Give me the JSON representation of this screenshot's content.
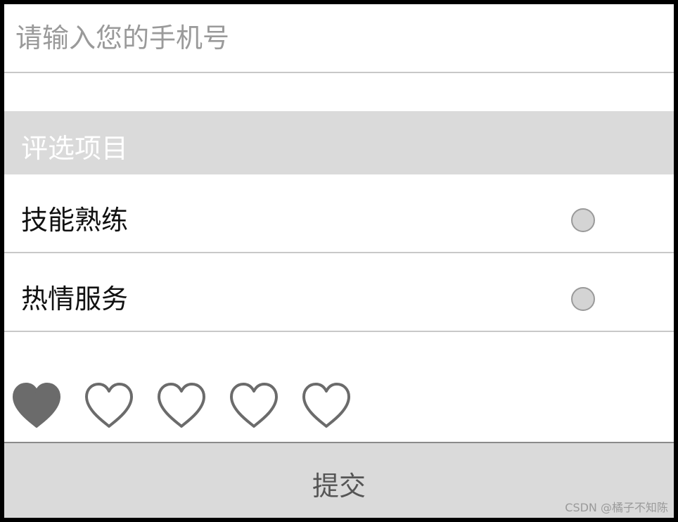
{
  "phone": {
    "placeholder": "请输入您的手机号",
    "value": ""
  },
  "section": {
    "title": "评选项目"
  },
  "options": [
    {
      "label": "技能熟练",
      "selected": false
    },
    {
      "label": "热情服务",
      "selected": false
    }
  ],
  "rating": {
    "value": 1,
    "max": 5,
    "filled_color": "#6b6b6b",
    "empty_color": "#6b6b6b"
  },
  "submit": {
    "label": "提交"
  },
  "watermark": "CSDN @橘子不知陈"
}
